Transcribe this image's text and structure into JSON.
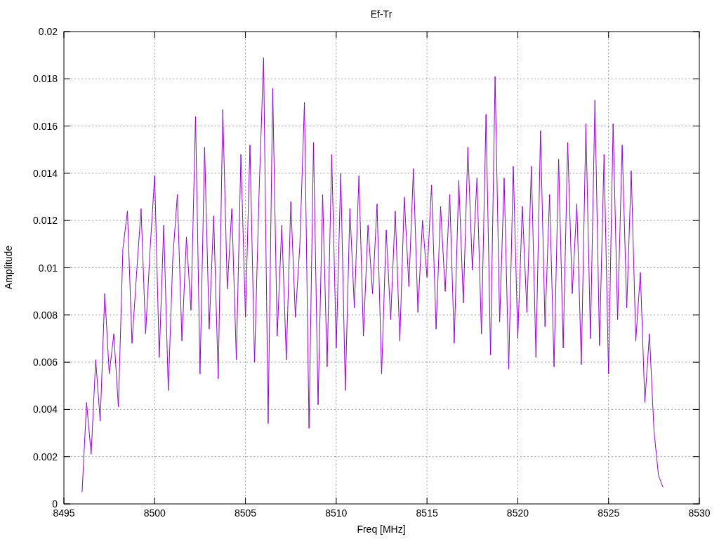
{
  "chart_data": {
    "type": "line",
    "title": "Ef-Tr",
    "xlabel": "Freq [MHz]",
    "ylabel": "Amplitude",
    "grid": true,
    "xlim": [
      8495,
      8530
    ],
    "ylim": [
      0,
      0.02
    ],
    "xticks": [
      8495,
      8500,
      8505,
      8510,
      8515,
      8520,
      8525,
      8530
    ],
    "yticks": [
      0,
      0.002,
      0.004,
      0.006,
      0.008,
      0.01,
      0.012,
      0.014,
      0.016,
      0.018,
      0.02
    ],
    "x": [
      8496,
      8496.25,
      8496.5,
      8496.75,
      8497,
      8497.25,
      8497.5,
      8497.75,
      8498,
      8498.25,
      8498.5,
      8498.75,
      8499,
      8499.25,
      8499.5,
      8499.75,
      8500,
      8500.25,
      8500.5,
      8500.75,
      8501,
      8501.25,
      8501.5,
      8501.75,
      8502,
      8502.25,
      8502.5,
      8502.75,
      8503,
      8503.25,
      8503.5,
      8503.75,
      8504,
      8504.25,
      8504.5,
      8504.75,
      8505,
      8505.25,
      8505.5,
      8505.75,
      8506,
      8506.25,
      8506.5,
      8506.75,
      8507,
      8507.25,
      8507.5,
      8507.75,
      8508,
      8508.25,
      8508.5,
      8508.75,
      8509,
      8509.25,
      8509.5,
      8509.75,
      8510,
      8510.25,
      8510.5,
      8510.75,
      8511,
      8511.25,
      8511.5,
      8511.75,
      8512,
      8512.25,
      8512.5,
      8512.75,
      8513,
      8513.25,
      8513.5,
      8513.75,
      8514,
      8514.25,
      8514.5,
      8514.75,
      8515,
      8515.25,
      8515.5,
      8515.75,
      8516,
      8516.25,
      8516.5,
      8516.75,
      8517,
      8517.25,
      8517.5,
      8517.75,
      8518,
      8518.25,
      8518.5,
      8518.75,
      8519,
      8519.25,
      8519.5,
      8519.75,
      8520,
      8520.25,
      8520.5,
      8520.75,
      8521,
      8521.25,
      8521.5,
      8521.75,
      8522,
      8522.25,
      8522.5,
      8522.75,
      8523,
      8523.25,
      8523.5,
      8523.75,
      8524,
      8524.25,
      8524.5,
      8524.75,
      8525,
      8525.25,
      8525.5,
      8525.75,
      8526,
      8526.25,
      8526.5,
      8526.75,
      8527,
      8527.25,
      8527.5,
      8527.75,
      8528
    ],
    "series": [
      {
        "color": "#9400d3",
        "values": [
          0.0005,
          0.0043,
          0.0021,
          0.0061,
          0.0035,
          0.0089,
          0.0055,
          0.0072,
          0.0041,
          0.0108,
          0.0124,
          0.0068,
          0.0097,
          0.0125,
          0.0072,
          0.0108,
          0.0139,
          0.0062,
          0.0118,
          0.0048,
          0.0104,
          0.0131,
          0.0069,
          0.0113,
          0.0082,
          0.0164,
          0.0055,
          0.0151,
          0.0074,
          0.0122,
          0.0053,
          0.0167,
          0.0091,
          0.0125,
          0.0061,
          0.0148,
          0.0079,
          0.0152,
          0.006,
          0.0132,
          0.0189,
          0.0034,
          0.0176,
          0.0071,
          0.0118,
          0.0061,
          0.0128,
          0.0079,
          0.011,
          0.017,
          0.0032,
          0.0153,
          0.0042,
          0.0131,
          0.0058,
          0.0148,
          0.0066,
          0.014,
          0.0048,
          0.0125,
          0.0083,
          0.0139,
          0.0071,
          0.0118,
          0.0089,
          0.0127,
          0.0055,
          0.0116,
          0.0078,
          0.0124,
          0.0069,
          0.013,
          0.0092,
          0.0142,
          0.0081,
          0.012,
          0.0096,
          0.0135,
          0.0074,
          0.0126,
          0.009,
          0.0131,
          0.0068,
          0.0137,
          0.0085,
          0.0151,
          0.0099,
          0.0138,
          0.0072,
          0.0165,
          0.0063,
          0.0181,
          0.0077,
          0.0138,
          0.0057,
          0.0143,
          0.007,
          0.0126,
          0.0081,
          0.0143,
          0.0062,
          0.0158,
          0.0075,
          0.0131,
          0.0058,
          0.0146,
          0.0066,
          0.0153,
          0.0089,
          0.0127,
          0.0059,
          0.0161,
          0.007,
          0.0171,
          0.0067,
          0.0148,
          0.0055,
          0.0161,
          0.0078,
          0.0152,
          0.0083,
          0.0141,
          0.0069,
          0.0098,
          0.0043,
          0.0072,
          0.0031,
          0.0012,
          0.0007
        ]
      }
    ]
  }
}
